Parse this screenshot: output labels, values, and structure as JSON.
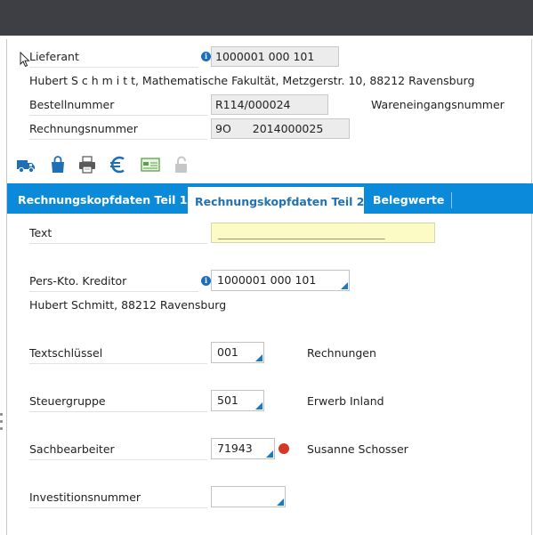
{
  "header": {
    "lieferant_label": "Lieferant",
    "lieferant_value": "1000001 000 101",
    "lieferant_address": "Hubert S c h m i t t, Mathematische Fakultät, Metzgerstr. 10, 88212 Ravensburg",
    "bestellnummer_label": "Bestellnummer",
    "bestellnummer_value": "R114/000024",
    "wareneingang_label": "Wareneingangsnummer",
    "rechnungsnummer_label": "Rechnungsnummer",
    "rechnungsnummer_prefix": "9O",
    "rechnungsnummer_value": "2014000025"
  },
  "toolbar": {
    "icons": [
      "truck-icon",
      "shopping-bag-icon",
      "printer-icon",
      "euro-icon",
      "payment-card-icon",
      "lock-icon"
    ]
  },
  "tabs": [
    {
      "label": "Rechnungskopfdaten Teil 1",
      "active": false
    },
    {
      "label": "Rechnungskopfdaten Teil 2",
      "active": true
    },
    {
      "label": "Belegwerte",
      "active": false
    }
  ],
  "form": {
    "text_label": "Text",
    "text_value": "______________________________",
    "kreditor_label": "Pers-Kto. Kreditor",
    "kreditor_value": "1000001 000 101",
    "kreditor_name": "Hubert Schmitt, 88212 Ravensburg",
    "textschluessel_label": "Textschlüssel",
    "textschluessel_value": "001",
    "textschluessel_desc": "Rechnungen",
    "steuergruppe_label": "Steuergruppe",
    "steuergruppe_value": "501",
    "steuergruppe_desc": "Erwerb Inland",
    "sachbearbeiter_label": "Sachbearbeiter",
    "sachbearbeiter_value": "71943",
    "sachbearbeiter_desc": "Susanne Schosser",
    "investition_label": "Investitionsnummer",
    "investition_value": ""
  },
  "colors": {
    "tab_bar": "#0a8ad8",
    "active_tab_text": "#2271b3",
    "input_corner": "#1a7bc4",
    "status_dot": "#d23a24",
    "text_field_bg": "#fdfbc5"
  }
}
